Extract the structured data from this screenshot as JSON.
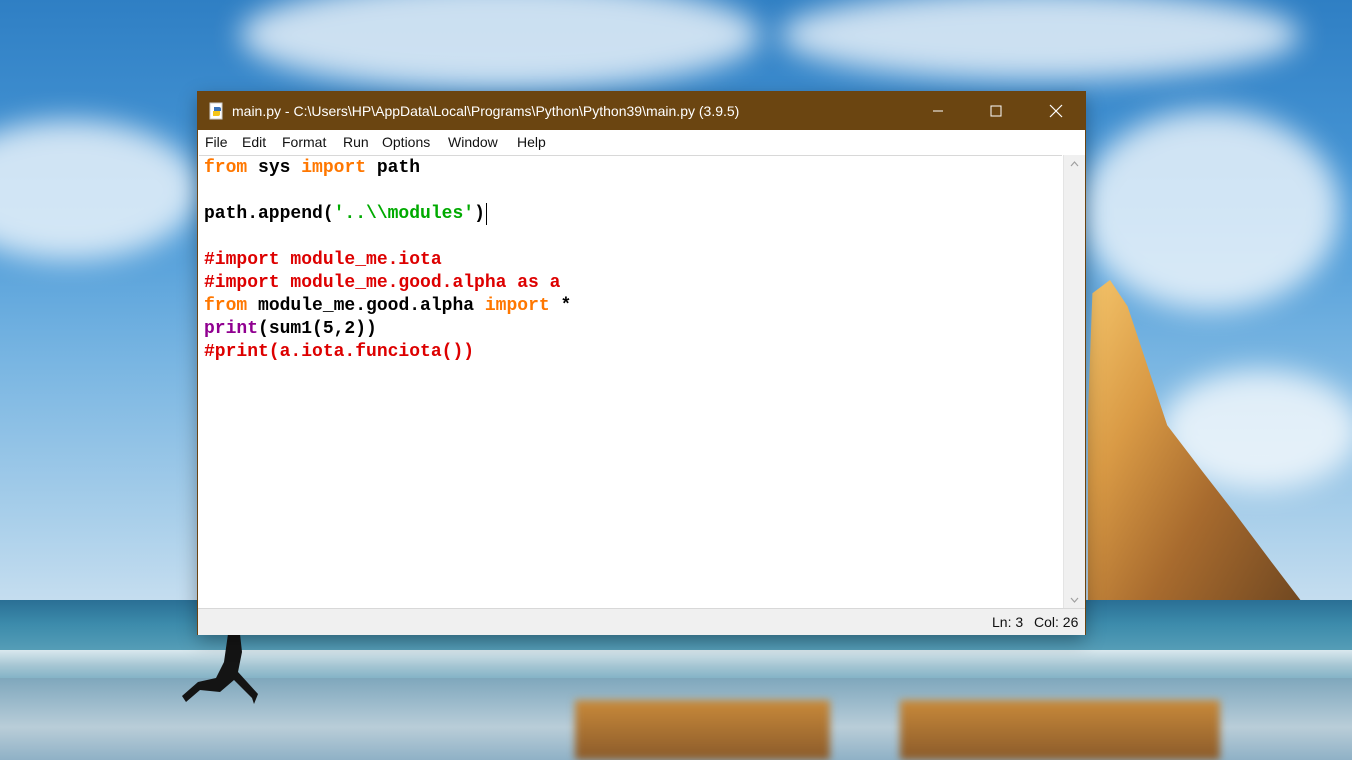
{
  "window": {
    "title": "main.py - C:\\Users\\HP\\AppData\\Local\\Programs\\Python\\Python39\\main.py (3.9.5)",
    "controls": {
      "minimize_icon": "minimize-icon",
      "maximize_icon": "maximize-icon",
      "close_icon": "close-icon"
    },
    "titlebar_color": "#6b4511"
  },
  "menu": {
    "items": [
      "File",
      "Edit",
      "Format",
      "Run",
      "Options",
      "Window",
      "Help"
    ]
  },
  "editor": {
    "lines": [
      [
        {
          "t": "from",
          "c": "kw"
        },
        {
          "t": " sys ",
          "c": ""
        },
        {
          "t": "import",
          "c": "kw"
        },
        {
          "t": " path",
          "c": ""
        }
      ],
      [],
      [
        {
          "t": "path.append(",
          "c": ""
        },
        {
          "t": "'..\\\\modules'",
          "c": "str"
        },
        {
          "t": ")",
          "c": ""
        }
      ],
      [],
      [
        {
          "t": "#import module_me.iota",
          "c": "cm"
        }
      ],
      [
        {
          "t": "#import module_me.good.alpha as a",
          "c": "cm"
        }
      ],
      [
        {
          "t": "from",
          "c": "kw"
        },
        {
          "t": " module_me.good.alpha ",
          "c": ""
        },
        {
          "t": "import",
          "c": "kw"
        },
        {
          "t": " *",
          "c": ""
        }
      ],
      [
        {
          "t": "print",
          "c": "bi"
        },
        {
          "t": "(sum1(5,2))",
          "c": ""
        }
      ],
      [
        {
          "t": "#print(a.iota.funciota())",
          "c": "cm"
        }
      ]
    ],
    "cursor_line": 3,
    "syntax_colors": {
      "keyword": "#ff7700",
      "string": "#00aa00",
      "comment": "#dd0000",
      "builtin": "#900090",
      "default": "#000000"
    }
  },
  "status": {
    "ln": "Ln: 3",
    "col": "Col: 26"
  }
}
